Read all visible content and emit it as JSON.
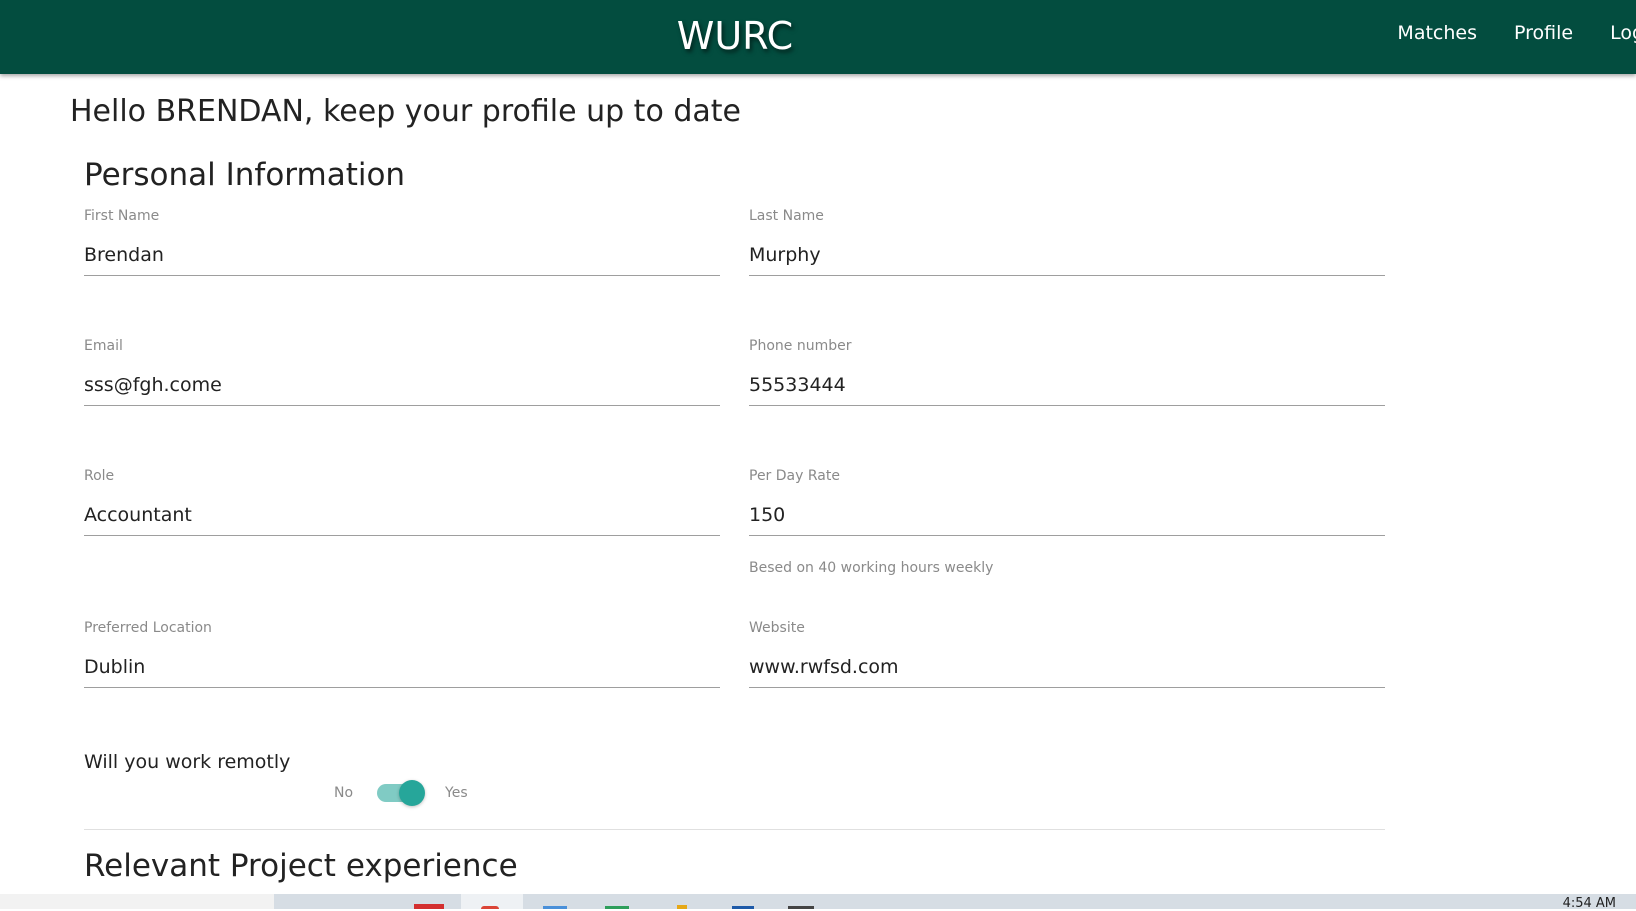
{
  "navbar": {
    "brand": "WURC",
    "links": [
      "Matches",
      "Profile",
      "Log"
    ]
  },
  "greeting": "Hello BRENDAN, keep your profile up to date",
  "personal_info": {
    "title": "Personal Information",
    "first_name": {
      "label": "First Name",
      "value": "Brendan"
    },
    "last_name": {
      "label": "Last Name",
      "value": "Murphy"
    },
    "email": {
      "label": "Email",
      "value": "sss@fgh.come"
    },
    "phone": {
      "label": "Phone number",
      "value": "55533444"
    },
    "role": {
      "label": "Role",
      "value": "Accountant"
    },
    "rate": {
      "label": "Per Day Rate",
      "value": "150",
      "helper": "Besed on 40 working hours weekly"
    },
    "location": {
      "label": "Preferred Location",
      "value": "Dublin"
    },
    "website": {
      "label": "Website",
      "value": "www.rwfsd.com"
    }
  },
  "remote": {
    "question": "Will you work remotly",
    "off_label": "No",
    "on_label": "Yes",
    "enabled": true
  },
  "project_section": {
    "title": "Relevant Project experience"
  },
  "taskbar": {
    "clock": "4:54 AM"
  },
  "colors": {
    "navbar": "#034d3f",
    "switch_track": "#80cbc4",
    "switch_knob": "#26a69a"
  }
}
